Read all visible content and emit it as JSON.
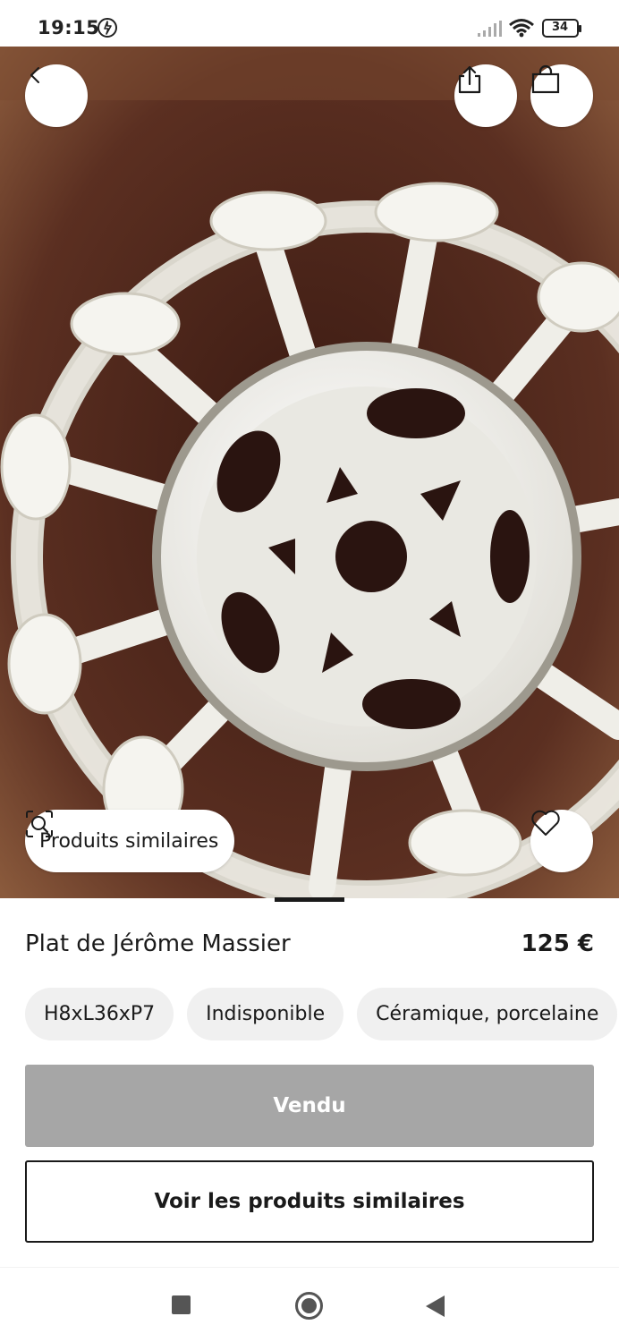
{
  "status_bar": {
    "time": "19:15",
    "battery": "34",
    "icons": [
      "alarm-icon",
      "signal-icon",
      "wifi-icon",
      "battery-icon"
    ]
  },
  "hero": {
    "image_subject": "openwork white ceramic dish",
    "similar_products_label": "Produits similaires",
    "icons": [
      "back-icon",
      "share-icon",
      "shopping-bag-icon",
      "visual-search-icon",
      "heart-icon"
    ]
  },
  "product": {
    "title": "Plat de Jérôme Massier",
    "price": "125 €",
    "chips": [
      "H8xL36xP7",
      "Indisponible",
      "Céramique, porcelaine"
    ]
  },
  "actions": {
    "sold_label": "Vendu",
    "see_similar_label": "Voir les produits similaires"
  },
  "colors": {
    "sold_button": "#a6a6a6",
    "chip_background": "#f0f0f0",
    "text": "#1a1a1a",
    "ceramic": "#efeee8",
    "wood": "#5b2f21"
  }
}
